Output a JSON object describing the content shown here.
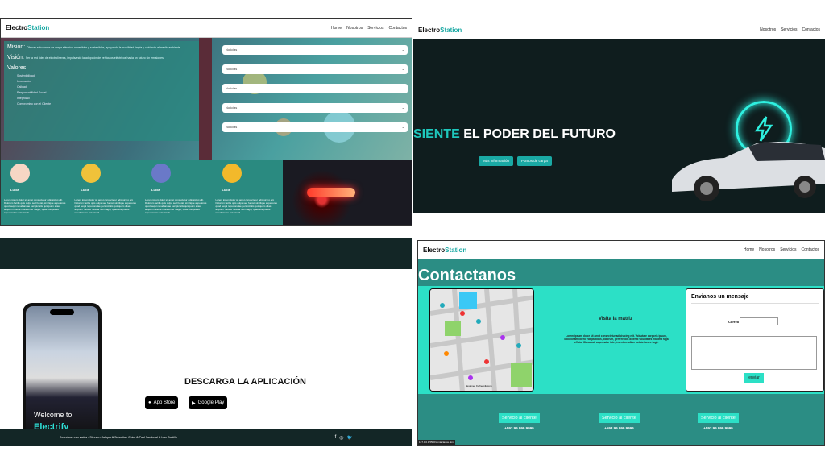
{
  "logo": {
    "pre": "Electro",
    "post": "Station"
  },
  "nav1": [
    "Home",
    "Nosotros",
    "Servicios",
    "Contactos"
  ],
  "nav2": [
    "Nosotros",
    "Servicios",
    "Contactos"
  ],
  "nav4": [
    "Home",
    "Nosotros",
    "Servicios",
    "Contactos"
  ],
  "about": {
    "mision_h": "Misión:",
    "mision_t": "Ofrecer soluciones de carga eléctrica accesibles y sostenibles, apoyando la movilidad limpia y cuidando el medio ambiente.",
    "vision_h": "Visión:",
    "vision_t": "Ser la red líder de electrolineras, impulsando la adopción de vehículos eléctricos hacia un futuro sin emisiones.",
    "valores_h": "Valores",
    "valores": [
      "Sostenibilidad",
      "Innovación",
      "Calidad",
      "Responsabilidad Social",
      "Integridad",
      "Compromiso con el Cliente"
    ],
    "select_label": "Noticias",
    "card_name": "Lucia",
    "card_text": "Lorem ipsum dolor sit amet consectetur adipisicing elit. Dolorum facilis quis culpa sed fuerat, similique asperiores quod sequi repudiandae perspiciatis quisquam alias aliquam ratione mollitia nisi magni, quae voluptates repudiandae voluptas?"
  },
  "hero": {
    "title_a": "SIENTE",
    "title_b": " EL PODER DEL FUTURO",
    "btn1": "Más información",
    "btn2": "Puntos de carga"
  },
  "download": {
    "title": "DESCARGA LA APLICACIÓN",
    "welcome": "Welcome to",
    "brand": "Electrify",
    "appstore": "App Store",
    "googleplay": "Google Play",
    "footer": "Derechos reservados - Steeven Caliqua & Sebastian Chico & Paul Sandoval & Ivan Castillo"
  },
  "contact": {
    "title": "Contactanos",
    "visita": "Visita la matriz",
    "lorem": "Lorem ipsum, dolor sit amet consectetur adipisicing elit. Voluptate corporis ipsum, laboriosam libero voluptatibus, dolorum, perferendis deleniti voluptates maxima fuga officia. Obcaecati aspernatur iste, inventore ullam soluta facere fugit.",
    "form_h": "Envianos un mensaje",
    "correo": "Correo",
    "enviar": "enviar",
    "map_credit": "designed by freepik.com",
    "services": [
      {
        "label": "Servicio al cliente",
        "phone": "+593 99 999 9999"
      },
      {
        "label": "Servicio al cliente",
        "phone": "+593 99 999 9999"
      },
      {
        "label": "Servicio al cliente",
        "phone": "+593 99 999 9999"
      }
    ],
    "url": "127.0.0.1:5500/contactanos.html"
  }
}
